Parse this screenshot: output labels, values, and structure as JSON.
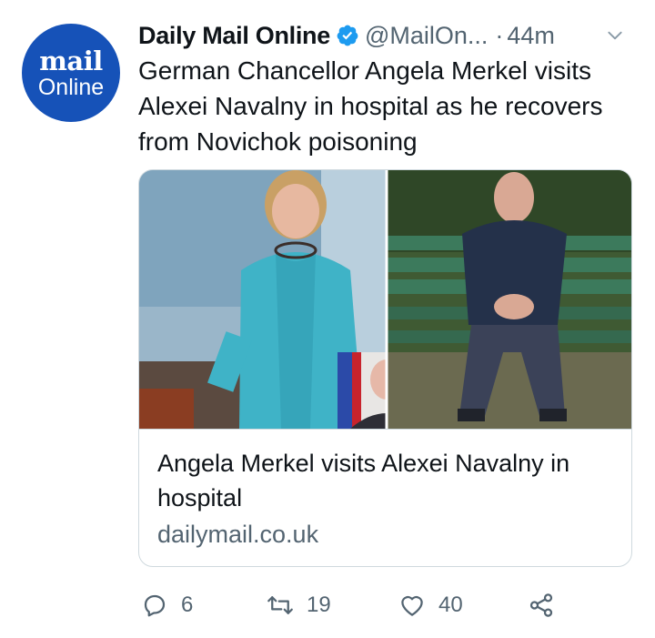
{
  "account": {
    "avatar_line1": "mail",
    "avatar_line2": "Online",
    "display_name": "Daily Mail Online",
    "handle": "@MailOn...",
    "separator": "·",
    "time": "44m"
  },
  "tweet": {
    "text": "German Chancellor Angela Merkel visits Alexei Navalny in hospital as he recovers from Novichok poisoning"
  },
  "card": {
    "title": "Angela Merkel visits Alexei Navalny in hospital",
    "domain": "dailymail.co.uk"
  },
  "actions": {
    "replies": "6",
    "retweets": "19",
    "likes": "40"
  },
  "colors": {
    "avatar_bg": "#1652b8",
    "verified": "#1d9bf0",
    "muted": "#536471",
    "border": "#cfd9de"
  },
  "icons": [
    "verified-badge-icon",
    "chevron-down-icon",
    "reply-icon",
    "retweet-icon",
    "like-icon",
    "share-icon"
  ]
}
